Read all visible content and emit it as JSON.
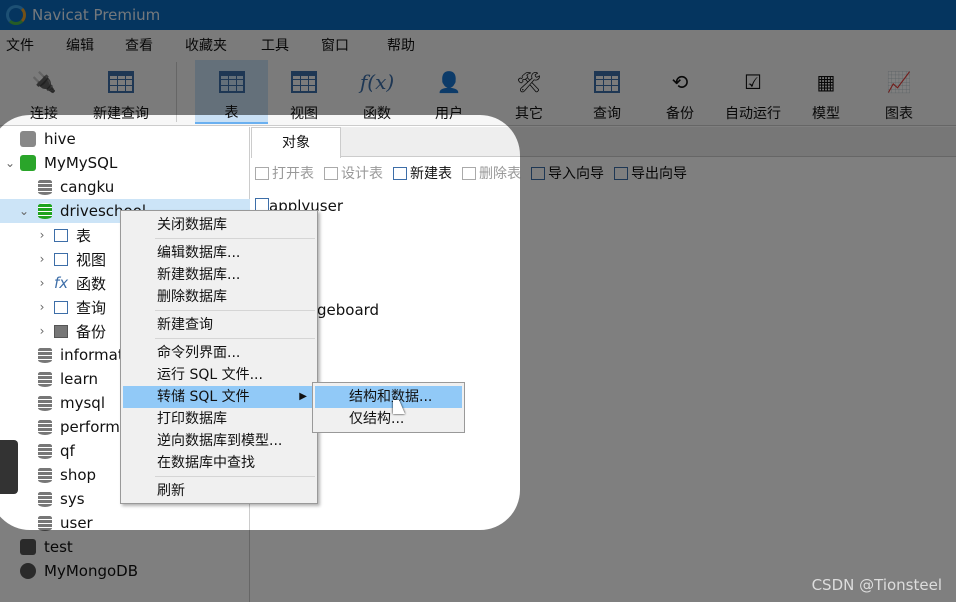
{
  "app": {
    "title": "Navicat Premium"
  },
  "menu": [
    "文件",
    "编辑",
    "查看",
    "收藏夹",
    "工具",
    "窗口",
    "帮助"
  ],
  "toolbar": [
    {
      "label": "连接",
      "icon": "plug-icon"
    },
    {
      "label": "新建查询",
      "icon": "new-query-icon"
    },
    {
      "label": "表",
      "icon": "table-icon",
      "active": true
    },
    {
      "label": "视图",
      "icon": "view-icon"
    },
    {
      "label": "函数",
      "icon": "function-icon"
    },
    {
      "label": "用户",
      "icon": "user-icon"
    },
    {
      "label": "其它",
      "icon": "tools-icon"
    },
    {
      "label": "查询",
      "icon": "query-icon"
    },
    {
      "label": "备份",
      "icon": "backup-icon"
    },
    {
      "label": "自动运行",
      "icon": "schedule-icon"
    },
    {
      "label": "模型",
      "icon": "model-icon"
    },
    {
      "label": "图表",
      "icon": "chart-icon"
    }
  ],
  "tree": [
    {
      "label": "hive"
    },
    {
      "label": "MyMySQL"
    },
    {
      "label": "cangku"
    },
    {
      "label": "driveschool"
    },
    {
      "label": "表"
    },
    {
      "label": "视图"
    },
    {
      "label": "函数"
    },
    {
      "label": "查询"
    },
    {
      "label": "备份"
    },
    {
      "label": "information_schema"
    },
    {
      "label": "learn"
    },
    {
      "label": "mysql"
    },
    {
      "label": "performance_schema"
    },
    {
      "label": "qf"
    },
    {
      "label": "shop"
    },
    {
      "label": "sys"
    },
    {
      "label": "user"
    },
    {
      "label": "test"
    },
    {
      "label": "MyMongoDB"
    }
  ],
  "main": {
    "tab": "对象",
    "actions": [
      "打开表",
      "设计表",
      "新建表",
      "删除表",
      "导入向导",
      "导出向导"
    ],
    "objects": [
      "applyuser",
      "geboard"
    ]
  },
  "context_menu": [
    "关闭数据库",
    "编辑数据库...",
    "新建数据库...",
    "删除数据库",
    "新建查询",
    "命令列界面...",
    "运行 SQL 文件...",
    "转储 SQL 文件",
    "打印数据库",
    "逆向数据库到模型...",
    "在数据库中查找",
    "刷新"
  ],
  "submenu": [
    "结构和数据...",
    "仅结构..."
  ],
  "watermark": "CSDN @Tionsteel"
}
